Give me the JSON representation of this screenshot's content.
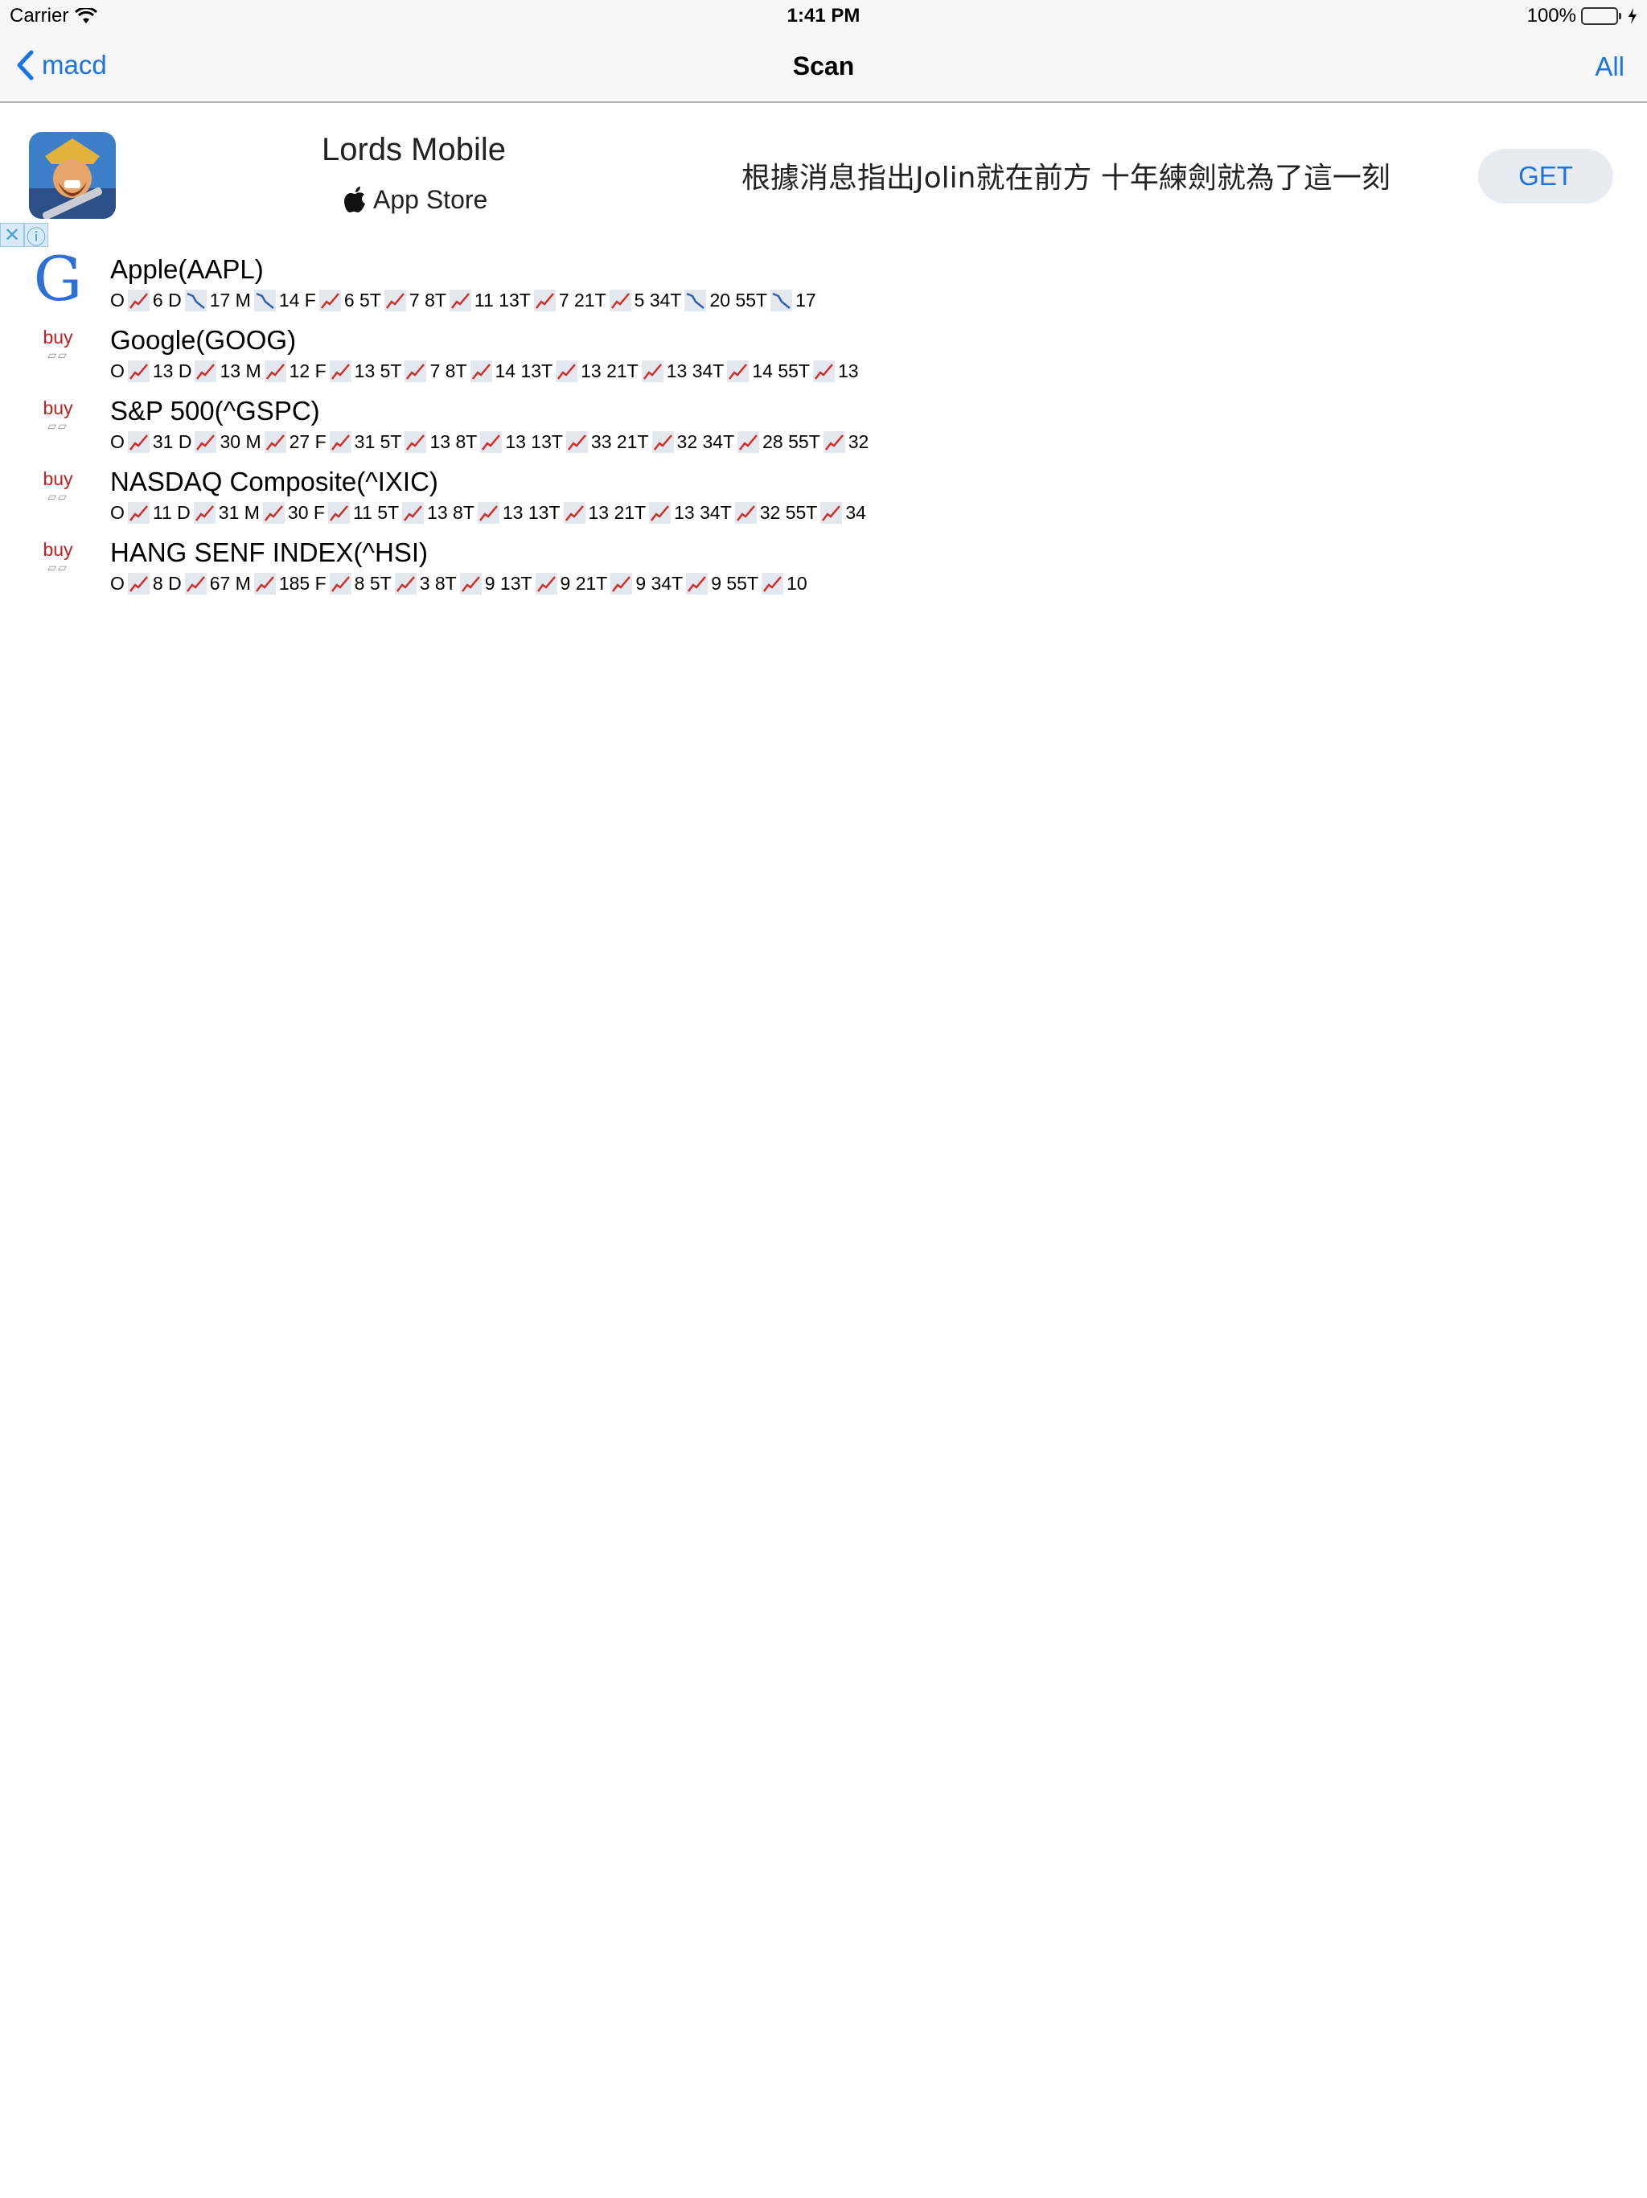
{
  "status_bar": {
    "carrier": "Carrier",
    "time": "1:41 PM",
    "battery": "100%",
    "battery_level": 1.0
  },
  "nav": {
    "back_label": "macd",
    "title": "Scan",
    "right_label": "All"
  },
  "ad": {
    "app_name": "Lords Mobile",
    "store": "App Store",
    "text": "根據消息指出Jolin就在前方 十年練劍就為了這一刻",
    "cta": "GET"
  },
  "rows": [
    {
      "badge": "google-logo",
      "name": "Apple(AAPL)",
      "stats": [
        [
          "O",
          "up"
        ],
        [
          "6 D",
          "down"
        ],
        [
          "17 M",
          "down"
        ],
        [
          "14 F",
          "up"
        ],
        [
          "6 5T",
          "up"
        ],
        [
          "7 8T",
          "up"
        ],
        [
          "11 13T",
          "up"
        ],
        [
          "7 21T",
          "up"
        ],
        [
          "5 34T",
          "down"
        ],
        [
          "20 55T",
          "down"
        ],
        [
          "17",
          ""
        ]
      ]
    },
    {
      "badge": "buy",
      "name": "Google(GOOG)",
      "stats": [
        [
          "O",
          "up"
        ],
        [
          "13 D",
          "up"
        ],
        [
          "13 M",
          "up"
        ],
        [
          "12 F",
          "up"
        ],
        [
          "13 5T",
          "up"
        ],
        [
          "7 8T",
          "up"
        ],
        [
          "14 13T",
          "up"
        ],
        [
          "13 21T",
          "up"
        ],
        [
          "13 34T",
          "up"
        ],
        [
          "14 55T",
          "up"
        ],
        [
          "13",
          ""
        ]
      ]
    },
    {
      "badge": "buy",
      "name": "S&P 500(^GSPC)",
      "stats": [
        [
          "O",
          "up"
        ],
        [
          "31 D",
          "up"
        ],
        [
          "30 M",
          "up"
        ],
        [
          "27 F",
          "up"
        ],
        [
          "31 5T",
          "up"
        ],
        [
          "13 8T",
          "up"
        ],
        [
          "13 13T",
          "up"
        ],
        [
          "33 21T",
          "up"
        ],
        [
          "32 34T",
          "up"
        ],
        [
          "28 55T",
          "up"
        ],
        [
          "32",
          ""
        ]
      ]
    },
    {
      "badge": "buy",
      "name": "NASDAQ Composite(^IXIC)",
      "stats": [
        [
          "O",
          "up"
        ],
        [
          "11 D",
          "up"
        ],
        [
          "31 M",
          "up"
        ],
        [
          "30 F",
          "up"
        ],
        [
          "11 5T",
          "up"
        ],
        [
          "13 8T",
          "up"
        ],
        [
          "13 13T",
          "up"
        ],
        [
          "13 21T",
          "up"
        ],
        [
          "13 34T",
          "up"
        ],
        [
          "32 55T",
          "up"
        ],
        [
          "34",
          ""
        ]
      ]
    },
    {
      "badge": "buy",
      "name": "HANG SENF INDEX(^HSI)",
      "stats": [
        [
          "O",
          "up"
        ],
        [
          "8 D",
          "up"
        ],
        [
          "67 M",
          "up"
        ],
        [
          "185 F",
          "up"
        ],
        [
          "8 5T",
          "up"
        ],
        [
          "3 8T",
          "up"
        ],
        [
          "9 13T",
          "up"
        ],
        [
          "9 21T",
          "up"
        ],
        [
          "9 34T",
          "up"
        ],
        [
          "9 55T",
          "up"
        ],
        [
          "10",
          ""
        ]
      ]
    }
  ],
  "colors": {
    "accent": "#1a73e8",
    "buy": "#c41e1e",
    "trend_up": "#d0302a",
    "trend_down": "#2e5fb0"
  }
}
